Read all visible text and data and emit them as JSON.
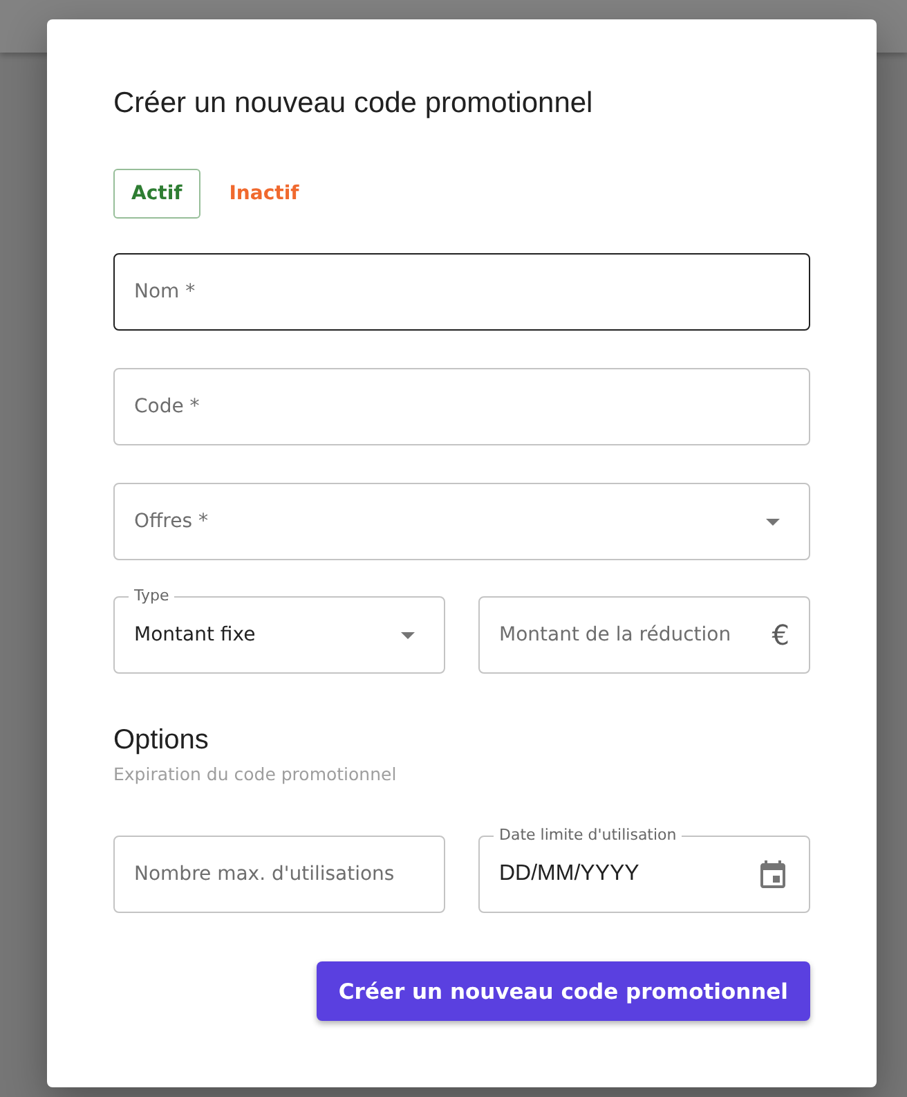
{
  "dialog": {
    "title": "Créer un nouveau code promotionnel"
  },
  "status_options": [
    {
      "label": "Actif",
      "selected": true,
      "color": "#2e7d32"
    },
    {
      "label": "Inactif",
      "selected": false,
      "color": "#f0692e"
    }
  ],
  "fields": [
    {
      "kind": "text",
      "placeholder": "Nom *",
      "hovered": true
    },
    {
      "kind": "text",
      "placeholder": "Code *",
      "hovered": false
    },
    {
      "kind": "select",
      "placeholder": "Offres *",
      "hovered": false
    }
  ],
  "discount_row": [
    {
      "kind": "select",
      "label": "Type",
      "value": "Montant fixe",
      "hovered": false
    },
    {
      "kind": "currency",
      "placeholder": "Montant de la réduction",
      "symbol": "€",
      "hovered": false
    }
  ],
  "options": {
    "heading": "Options",
    "subtitle": "Expiration du code promotionnel",
    "fields": [
      {
        "kind": "text",
        "placeholder": "Nombre max. d'utilisations",
        "hovered": false
      },
      {
        "kind": "date",
        "label": "Date limite d'utilisation",
        "value": "DD/MM/YYYY",
        "hovered": false
      }
    ]
  },
  "submit_button": {
    "label": "Créer un nouveau code promotionnel"
  }
}
